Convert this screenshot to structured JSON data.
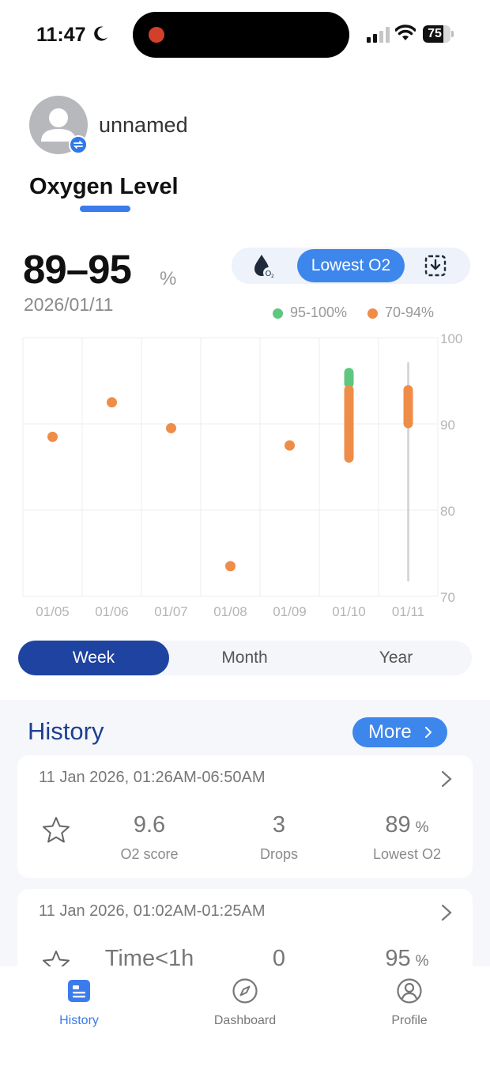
{
  "status_bar": {
    "time": "11:47",
    "battery": "75",
    "battery_fraction": 0.75,
    "icons": [
      "moon-icon",
      "signal-icon",
      "wifi-icon",
      "battery-icon"
    ]
  },
  "profile": {
    "name": "unnamed",
    "avatar_icon": "person-icon",
    "switch_icon": "swap-icon"
  },
  "page": {
    "title": "Oxygen Level"
  },
  "summary": {
    "range": "89–95",
    "unit": "%",
    "date": "2026/01/11"
  },
  "metric_switch": {
    "left_icon": "o2-drop-icon",
    "active_label": "Lowest O2",
    "right_icon": "export-icon"
  },
  "legend": [
    {
      "label": "95-100%",
      "color": "#5ec77f"
    },
    {
      "label": "70-94%",
      "color": "#ef8d48"
    }
  ],
  "chart_data": {
    "type": "scatter",
    "categories": [
      "01/05",
      "01/06",
      "01/07",
      "01/08",
      "01/09",
      "01/10",
      "01/11"
    ],
    "ylim": [
      70,
      100
    ],
    "yticks": [
      100,
      90,
      80,
      70
    ],
    "grid": true,
    "points": [
      {
        "x": "01/05",
        "y": 88.5
      },
      {
        "x": "01/06",
        "y": 92.5
      },
      {
        "x": "01/07",
        "y": 89.5
      },
      {
        "x": "01/08",
        "y": 73.5
      },
      {
        "x": "01/09",
        "y": 87.5
      }
    ],
    "ranges": [
      {
        "x": "01/10",
        "low": 85.5,
        "high": 96.5
      },
      {
        "x": "01/11",
        "low": 89.5,
        "high": 94.5
      }
    ],
    "selected": "01/11",
    "colors": {
      "normal": "#5ec77f",
      "low": "#ef8d48",
      "threshold": 94.5
    }
  },
  "period_tabs": [
    {
      "label": "Week",
      "active": true
    },
    {
      "label": "Month",
      "active": false
    },
    {
      "label": "Year",
      "active": false
    }
  ],
  "history": {
    "title": "History",
    "more_label": "More",
    "records": [
      {
        "range": "11 Jan 2026, 01:26AM-06:50AM",
        "stats": [
          {
            "value": "9.6",
            "unit": "",
            "label": "O2 score"
          },
          {
            "value": "3",
            "unit": "",
            "label": "Drops"
          },
          {
            "value": "89",
            "unit": "%",
            "label": "Lowest O2"
          }
        ]
      },
      {
        "range": "11 Jan 2026, 01:02AM-01:25AM",
        "stats": [
          {
            "value": "Time<1h",
            "unit": "",
            "label": ""
          },
          {
            "value": "0",
            "unit": "",
            "label": ""
          },
          {
            "value": "95",
            "unit": "%",
            "label": ""
          }
        ]
      }
    ]
  },
  "nav": [
    {
      "label": "History",
      "icon": "history-icon",
      "active": true
    },
    {
      "label": "Dashboard",
      "icon": "compass-icon",
      "active": false
    },
    {
      "label": "Profile",
      "icon": "profile-icon",
      "active": false
    }
  ]
}
